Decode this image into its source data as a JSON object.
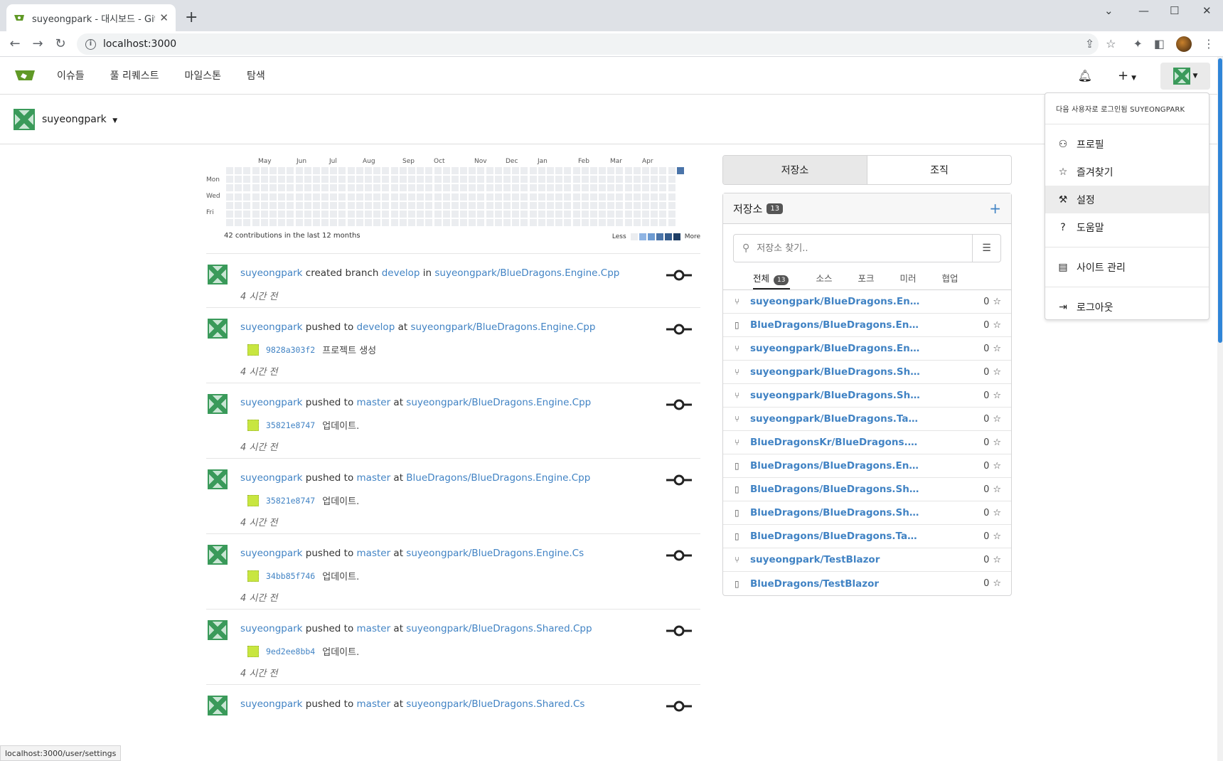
{
  "browser": {
    "tab_title": "suyeongpark - 대시보드 - Gitea",
    "url": "localhost:3000",
    "status_url": "localhost:3000/user/settings"
  },
  "nav": {
    "issues": "이슈들",
    "pulls": "풀 리퀘스트",
    "milestones": "마일스톤",
    "explore": "탐색"
  },
  "context_user": "suyeongpark",
  "heatmap": {
    "months": [
      "May",
      "Jun",
      "Jul",
      "Aug",
      "Sep",
      "Oct",
      "Nov",
      "Dec",
      "Jan",
      "Feb",
      "Mar",
      "Apr"
    ],
    "days": [
      "Mon",
      "Wed",
      "Fri"
    ],
    "summary": "42 contributions in the last 12 months",
    "less": "Less",
    "more": "More",
    "legend_colors": [
      "#ebedf0",
      "#8fb4e3",
      "#6d9bd2",
      "#4a74a9",
      "#345b8c",
      "#1f3f66"
    ]
  },
  "feed": [
    {
      "user": "suyeongpark",
      "action": "created branch",
      "ref": "develop",
      "prep": "in",
      "repo": "suyeongpark/BlueDragons.Engine.Cpp",
      "commit_sha": "",
      "commit_msg": "",
      "ago": "4 시간 전"
    },
    {
      "user": "suyeongpark",
      "action": "pushed to",
      "ref": "develop",
      "prep": "at",
      "repo": "suyeongpark/BlueDragons.Engine.Cpp",
      "commit_sha": "9828a303f2",
      "commit_msg": "프로젝트 생성",
      "ago": "4 시간 전"
    },
    {
      "user": "suyeongpark",
      "action": "pushed to",
      "ref": "master",
      "prep": "at",
      "repo": "suyeongpark/BlueDragons.Engine.Cpp",
      "commit_sha": "35821e8747",
      "commit_msg": "업데이트.",
      "ago": "4 시간 전"
    },
    {
      "user": "suyeongpark",
      "action": "pushed to",
      "ref": "master",
      "prep": "at",
      "repo": "BlueDragons/BlueDragons.Engine.Cpp",
      "commit_sha": "35821e8747",
      "commit_msg": "업데이트.",
      "ago": "4 시간 전"
    },
    {
      "user": "suyeongpark",
      "action": "pushed to",
      "ref": "master",
      "prep": "at",
      "repo": "suyeongpark/BlueDragons.Engine.Cs",
      "commit_sha": "34bb85f746",
      "commit_msg": "업데이트.",
      "ago": "4 시간 전"
    },
    {
      "user": "suyeongpark",
      "action": "pushed to",
      "ref": "master",
      "prep": "at",
      "repo": "suyeongpark/BlueDragons.Shared.Cpp",
      "commit_sha": "9ed2ee8bb4",
      "commit_msg": "업데이트.",
      "ago": "4 시간 전"
    },
    {
      "user": "suyeongpark",
      "action": "pushed to",
      "ref": "master",
      "prep": "at",
      "repo": "suyeongpark/BlueDragons.Shared.Cs",
      "commit_sha": "",
      "commit_msg": "",
      "ago": ""
    }
  ],
  "repo_panel": {
    "tab_repos": "저장소",
    "tab_orgs": "조직",
    "header": "저장소",
    "count": "13",
    "search_placeholder": "저장소 찾기..",
    "filters": [
      "전체",
      "소스",
      "포크",
      "미러",
      "협업"
    ],
    "all_count": "13",
    "repos": [
      {
        "name": "suyeongpark/BlueDragons.Engine.C...",
        "kind": "fork",
        "stars": "0"
      },
      {
        "name": "BlueDragons/BlueDragons.Engine.C...",
        "kind": "repo",
        "stars": "0"
      },
      {
        "name": "suyeongpark/BlueDragons.Engine.Cs",
        "kind": "fork",
        "stars": "0"
      },
      {
        "name": "suyeongpark/BlueDragons.Shared.C...",
        "kind": "fork",
        "stars": "0"
      },
      {
        "name": "suyeongpark/BlueDragons.Shared.Cs",
        "kind": "fork",
        "stars": "0"
      },
      {
        "name": "suyeongpark/BlueDragons.TaskMan...",
        "kind": "fork",
        "stars": "0"
      },
      {
        "name": "BlueDragonsKr/BlueDragons.TaskM...",
        "kind": "fork",
        "stars": "0"
      },
      {
        "name": "BlueDragons/BlueDragons.Engine.Cs",
        "kind": "repo",
        "stars": "0"
      },
      {
        "name": "BlueDragons/BlueDragons.Shared.C...",
        "kind": "repo",
        "stars": "0"
      },
      {
        "name": "BlueDragons/BlueDragons.Shared.Cs",
        "kind": "repo",
        "stars": "0"
      },
      {
        "name": "BlueDragons/BlueDragons.TaskMan...",
        "kind": "repo",
        "stars": "0"
      },
      {
        "name": "suyeongpark/TestBlazor",
        "kind": "fork",
        "stars": "0"
      },
      {
        "name": "BlueDragons/TestBlazor",
        "kind": "repo",
        "stars": "0"
      }
    ]
  },
  "user_menu": {
    "signed_in_as": "다음 사용자로 로그인됨 SUYEONGPARK",
    "profile": "프로필",
    "starred": "즐겨찾기",
    "settings": "설정",
    "help": "도움말",
    "site_admin": "사이트 관리",
    "logout": "로그아웃"
  }
}
